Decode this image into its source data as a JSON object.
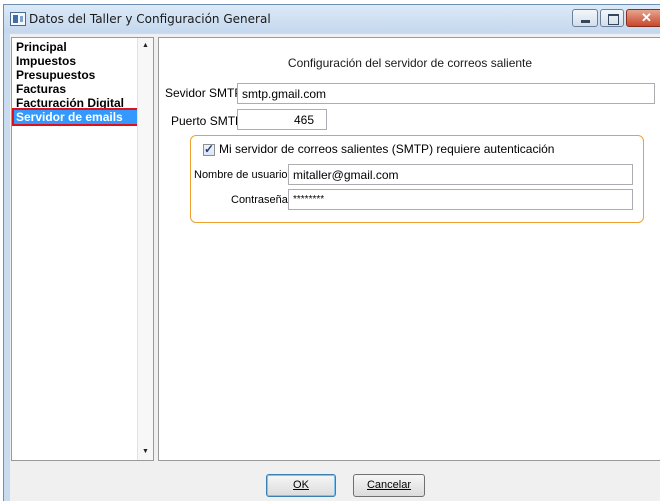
{
  "window": {
    "title": "Datos del Taller y Configuración General"
  },
  "sidebar": {
    "items": [
      {
        "label": "Principal"
      },
      {
        "label": "Impuestos"
      },
      {
        "label": "Presupuestos"
      },
      {
        "label": "Facturas"
      },
      {
        "label": "Facturación Digital"
      },
      {
        "label": "Servidor de emails",
        "selected": true
      }
    ],
    "selected_color": "#3399ff",
    "highlight_color": "#e0101a"
  },
  "smtp": {
    "heading": "Configuración del servidor de correos saliente",
    "server_label": "Sevidor SMTP",
    "server_value": "smtp.gmail.com",
    "port_label": "Puerto SMTP",
    "port_value": "465",
    "auth_checkbox_label": "Mi servidor de correos salientes (SMTP) requiere autenticación",
    "auth_checked": true,
    "username_label": "Nombre de usuario",
    "username_value": "mitaller@gmail.com",
    "password_label": "Contraseña",
    "password_value": "********",
    "group_border_color": "#f0a030"
  },
  "buttons": {
    "ok_label": "OK",
    "cancel_label": "Cancelar"
  }
}
